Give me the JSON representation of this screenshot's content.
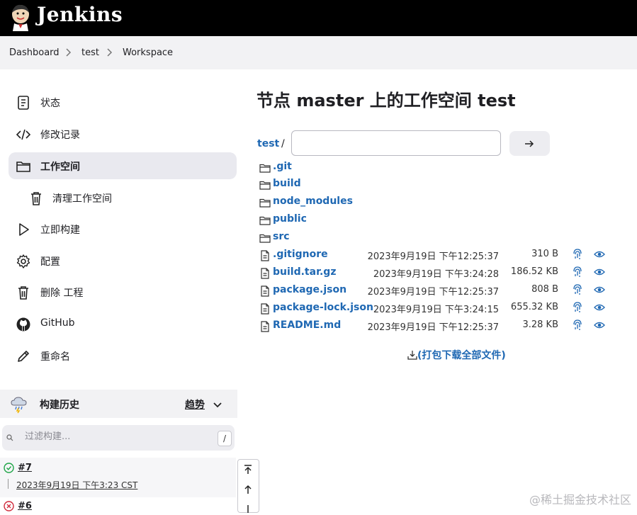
{
  "header": {
    "brand": "Jenkins",
    "logo": "jenkins-butler-logo"
  },
  "breadcrumb": [
    {
      "label": "Dashboard"
    },
    {
      "label": "test"
    },
    {
      "label": "Workspace"
    }
  ],
  "sidebar": {
    "items": [
      {
        "label": "状态",
        "icon": "document-icon"
      },
      {
        "label": "修改记录",
        "icon": "code-icon"
      },
      {
        "label": "工作空间",
        "icon": "folder-icon",
        "active": true
      },
      {
        "label": "清理工作空间",
        "icon": "trash-icon",
        "sub": true
      },
      {
        "label": "立即构建",
        "icon": "play-icon"
      },
      {
        "label": "配置",
        "icon": "gear-icon"
      },
      {
        "label": "删除 工程",
        "icon": "trash-icon"
      },
      {
        "label": "GitHub",
        "icon": "github-icon"
      },
      {
        "label": "重命名",
        "icon": "pencil-icon"
      }
    ]
  },
  "build_history": {
    "title": "构建历史",
    "trend_label": "趋势",
    "filter_placeholder": "过滤构建...",
    "filter_shortcut": "/",
    "builds": [
      {
        "number": "#7",
        "date": "2023年9月19日 下午3:23 CST",
        "status": "success"
      },
      {
        "number": "#6",
        "date": "",
        "status": "failed"
      }
    ]
  },
  "main": {
    "title": "节点 master 上的工作空间 test",
    "path_root": "test",
    "path_sep": "/",
    "path_input_value": "",
    "entries": [
      {
        "name": ".git",
        "type": "folder"
      },
      {
        "name": "build",
        "type": "folder"
      },
      {
        "name": "node_modules",
        "type": "folder"
      },
      {
        "name": "public",
        "type": "folder"
      },
      {
        "name": "src",
        "type": "folder"
      },
      {
        "name": ".gitignore",
        "type": "file",
        "date": "2023年9月19日 下午12:25:37",
        "size": "310 B"
      },
      {
        "name": "build.tar.gz",
        "type": "file",
        "date": "2023年9月19日 下午3:24:28",
        "size": "186.52 KB"
      },
      {
        "name": "package.json",
        "type": "file",
        "date": "2023年9月19日 下午12:25:37",
        "size": "808 B"
      },
      {
        "name": "package-lock.json",
        "type": "file",
        "date": "2023年9月19日 下午3:24:15",
        "size": "655.32 KB"
      },
      {
        "name": "README.md",
        "type": "file",
        "date": "2023年9月19日 下午12:25:37",
        "size": "3.28 KB"
      }
    ],
    "download_all": "(打包下载全部文件)"
  },
  "watermark": "@稀土掘金技术社区",
  "colors": {
    "link": "#1f68b3",
    "header_bg": "#000000",
    "success": "#1ea446",
    "failed": "#d02b3c"
  }
}
